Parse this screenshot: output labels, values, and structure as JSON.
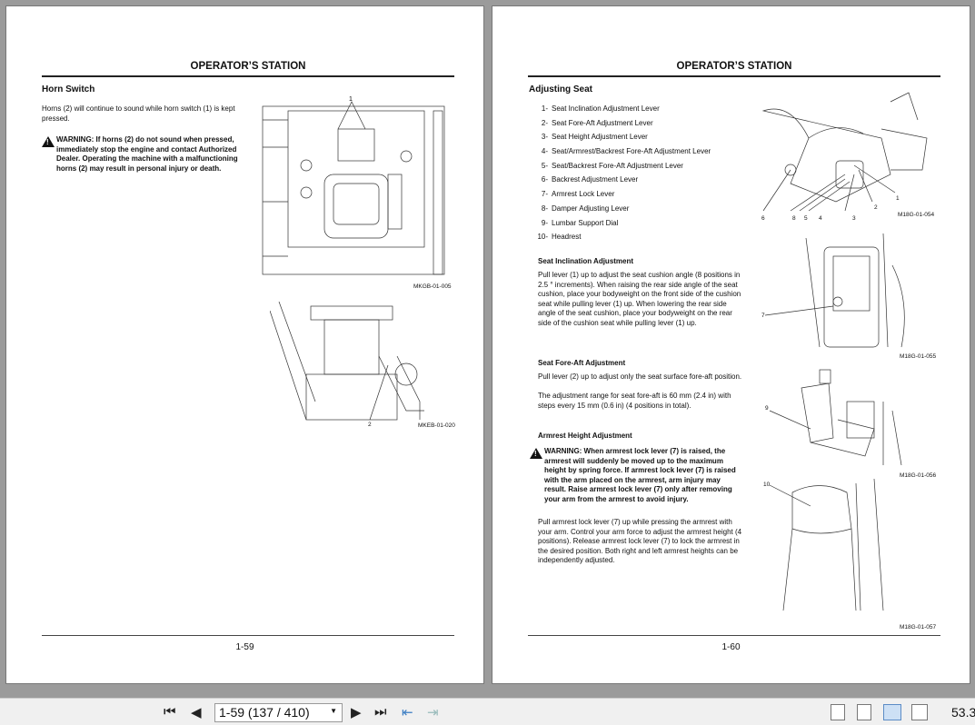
{
  "left_page": {
    "header": "OPERATOR’S STATION",
    "section_title": "Horn Switch",
    "body": "Horns (2) will continue to sound while horn switch (1) is kept pressed.",
    "warning": "WARNING:   If horns (2) do not sound when pressed, immediately stop the engine and contact Authorized Dealer. Operating the machine with a malfunctioning horns (2) may result in personal injury or death.",
    "figures": [
      {
        "id": "MKGB-01-005",
        "callouts": [
          "1"
        ]
      },
      {
        "id": "MKEB-01-020",
        "callouts": [
          "2"
        ]
      }
    ],
    "page_number": "1-59"
  },
  "right_page": {
    "header": "OPERATOR’S STATION",
    "section_title": "Adjusting Seat",
    "items": [
      {
        "n": "1-",
        "label": "Seat Inclination Adjustment Lever"
      },
      {
        "n": "2-",
        "label": "Seat Fore-Aft Adjustment Lever"
      },
      {
        "n": "3-",
        "label": "Seat Height Adjustment Lever"
      },
      {
        "n": "4-",
        "label": "Seat/Armrest/Backrest Fore-Aft Adjustment Lever"
      },
      {
        "n": "5-",
        "label": "Seat/Backrest Fore-Aft Adjustment Lever"
      },
      {
        "n": "6-",
        "label": "Backrest Adjustment Lever"
      },
      {
        "n": "7-",
        "label": "Armrest Lock Lever"
      },
      {
        "n": "8-",
        "label": "Damper Adjusting Lever"
      },
      {
        "n": "9-",
        "label": "Lumbar Support Dial"
      },
      {
        "n": "10-",
        "label": "Headrest"
      }
    ],
    "inclination": {
      "title": "Seat Inclination Adjustment",
      "body": "Pull lever (1) up to adjust the seat cushion angle (8 positions in 2.5 ° increments). When raising the rear side angle of the seat cushion, place your bodyweight on the front side of the cushion seat while pulling lever (1) up. When lowering the rear side angle of the seat cushion, place your bodyweight on the rear side of the cushion seat while pulling lever (1) up."
    },
    "fore_aft": {
      "title": "Seat Fore-Aft Adjustment",
      "body1": "Pull lever (2) up to adjust only the seat surface fore-aft position.",
      "body2": "The adjustment range for seat fore-aft is 60 mm (2.4 in) with steps every 15 mm (0.6 in) (4 positions in total)."
    },
    "armrest": {
      "title": "Armrest Height Adjustment",
      "warning": "WARNING:   When armrest lock lever (7) is raised, the armrest will suddenly be moved up to the maximum height by spring force. If armrest lock lever (7) is raised with the arm placed on the armrest, arm injury may result. Raise armrest lock lever (7) only after removing your arm from the armrest to avoid injury.",
      "body": "Pull armrest lock lever (7) up while pressing the armrest with your arm. Control your arm force to adjust the armrest height (4 positions). Release armrest lock lever (7) to lock the armrest in the desired position. Both right and left armrest heights can be independently adjusted."
    },
    "figures": [
      {
        "id": "M18G-01-054",
        "callouts": [
          "6",
          "8",
          "5",
          "4",
          "3",
          "2",
          "1"
        ]
      },
      {
        "id": "M18G-01-055",
        "callouts": [
          "7"
        ]
      },
      {
        "id": "M18G-01-056",
        "callouts": [
          "9"
        ]
      },
      {
        "id": "M18G-01-057",
        "callouts": [
          "10"
        ]
      }
    ],
    "page_number": "1-60"
  },
  "toolbar": {
    "page_field": "1-59 (137 / 410)",
    "zoom": "53.3"
  }
}
